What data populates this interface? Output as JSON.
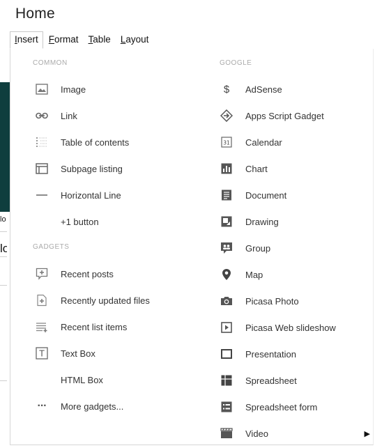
{
  "page": {
    "title": "Home"
  },
  "menubar": {
    "items": [
      {
        "first": "I",
        "rest": "nsert"
      },
      {
        "first": "F",
        "rest": "ormat"
      },
      {
        "first": "T",
        "rest": "able"
      },
      {
        "first": "L",
        "rest": "ayout"
      }
    ]
  },
  "background": {
    "frag1": "lo",
    "frag2": "lo"
  },
  "insert_menu": {
    "common": {
      "header": "COMMON",
      "items": [
        {
          "label": "Image",
          "icon": "image-icon"
        },
        {
          "label": "Link",
          "icon": "link-icon"
        },
        {
          "label": "Table of contents",
          "icon": "table-of-contents-icon"
        },
        {
          "label": "Subpage listing",
          "icon": "subpage-listing-icon"
        },
        {
          "label": "Horizontal Line",
          "icon": "horizontal-line-icon"
        },
        {
          "label": "+1 button",
          "icon": ""
        }
      ]
    },
    "gadgets": {
      "header": "GADGETS",
      "items": [
        {
          "label": "Recent posts",
          "icon": "recent-posts-icon"
        },
        {
          "label": "Recently updated files",
          "icon": "recently-updated-files-icon"
        },
        {
          "label": "Recent list items",
          "icon": "recent-list-items-icon"
        },
        {
          "label": "Text Box",
          "icon": "text-box-icon"
        },
        {
          "label": "HTML Box",
          "icon": ""
        },
        {
          "label": "More gadgets...",
          "icon": "more-gadgets-icon"
        }
      ]
    },
    "google": {
      "header": "GOOGLE",
      "items": [
        {
          "label": "AdSense",
          "icon": "dollar-icon"
        },
        {
          "label": "Apps Script Gadget",
          "icon": "apps-script-icon"
        },
        {
          "label": "Calendar",
          "icon": "calendar-icon",
          "glyph": "31"
        },
        {
          "label": "Chart",
          "icon": "chart-icon"
        },
        {
          "label": "Document",
          "icon": "document-icon"
        },
        {
          "label": "Drawing",
          "icon": "drawing-icon"
        },
        {
          "label": "Group",
          "icon": "group-icon"
        },
        {
          "label": "Map",
          "icon": "map-pin-icon"
        },
        {
          "label": "Picasa Photo",
          "icon": "camera-icon"
        },
        {
          "label": "Picasa Web slideshow",
          "icon": "slideshow-icon"
        },
        {
          "label": "Presentation",
          "icon": "presentation-icon"
        },
        {
          "label": "Spreadsheet",
          "icon": "spreadsheet-icon"
        },
        {
          "label": "Spreadsheet form",
          "icon": "spreadsheet-form-icon"
        },
        {
          "label": "Video",
          "icon": "video-icon"
        }
      ]
    },
    "glyphs": {
      "dollar": "$",
      "text_box": "T",
      "more": "···",
      "submenu_arrow": "▶"
    }
  }
}
